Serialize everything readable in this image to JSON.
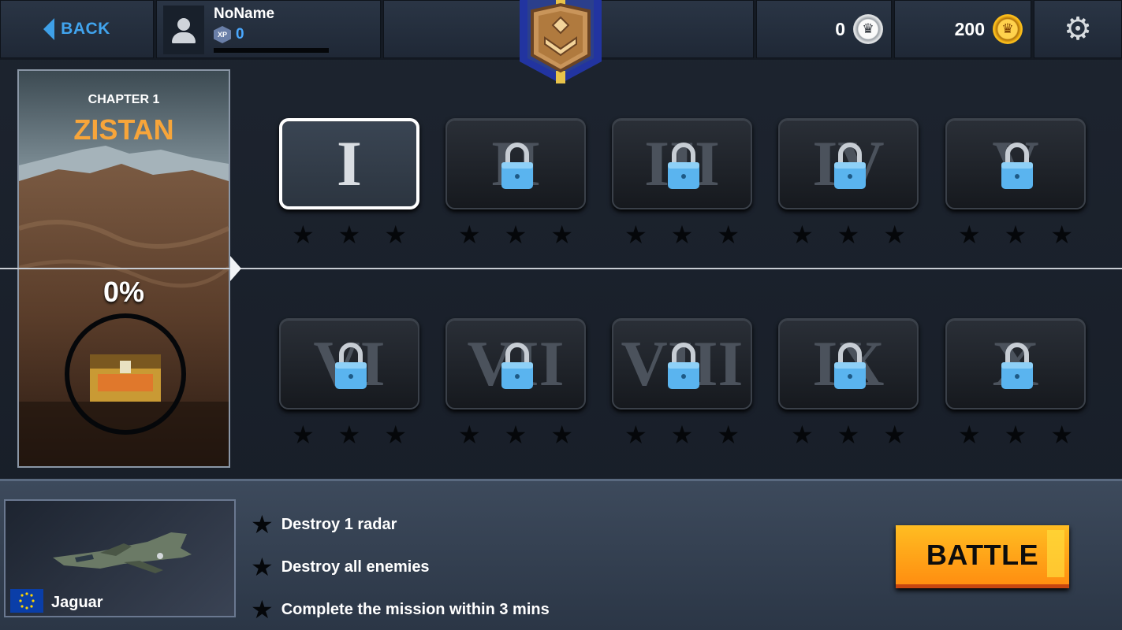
{
  "header": {
    "back_label": "BACK",
    "player_name": "NoName",
    "xp_label": "XP",
    "xp_value": "0",
    "xp_progress": 0,
    "silver_currency": "0",
    "gold_currency": "200"
  },
  "chapter": {
    "label": "CHAPTER 1",
    "name": "ZISTAN",
    "progress": "0%"
  },
  "levels": [
    {
      "numeral": "I",
      "locked": false,
      "selected": true,
      "stars": 0
    },
    {
      "numeral": "II",
      "locked": true,
      "selected": false,
      "stars": 0
    },
    {
      "numeral": "III",
      "locked": true,
      "selected": false,
      "stars": 0
    },
    {
      "numeral": "IV",
      "locked": true,
      "selected": false,
      "stars": 0
    },
    {
      "numeral": "V",
      "locked": true,
      "selected": false,
      "stars": 0
    },
    {
      "numeral": "VI",
      "locked": true,
      "selected": false,
      "stars": 0
    },
    {
      "numeral": "VII",
      "locked": true,
      "selected": false,
      "stars": 0
    },
    {
      "numeral": "VIII",
      "locked": true,
      "selected": false,
      "stars": 0
    },
    {
      "numeral": "IX",
      "locked": true,
      "selected": false,
      "stars": 0
    },
    {
      "numeral": "X",
      "locked": true,
      "selected": false,
      "stars": 0
    }
  ],
  "aircraft": {
    "name": "Jaguar"
  },
  "objectives": [
    "Destroy 1 radar",
    "Destroy all enemies",
    "Complete the mission within 3 mins"
  ],
  "battle_label": "BATTLE",
  "colors": {
    "accent_blue": "#41a4ee",
    "chapter_orange": "#f7a53a",
    "battle_orange": "#ffa01a",
    "lock_blue": "#5ab4ef"
  }
}
